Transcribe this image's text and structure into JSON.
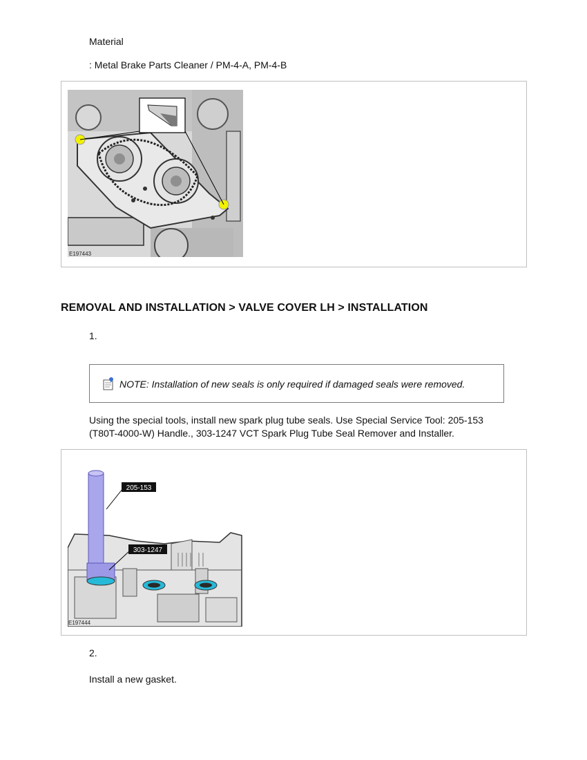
{
  "material": {
    "heading": "Material",
    "line": ": Metal Brake Parts Cleaner / PM-4-A, PM-4-B"
  },
  "figures": {
    "fig1_id": "E197443",
    "fig2_id": "E197444",
    "fig2_callout_handle": "205-153",
    "fig2_callout_tool": "303-1247"
  },
  "section": {
    "title": "REMOVAL AND INSTALLATION > VALVE COVER LH > INSTALLATION"
  },
  "step1": {
    "number": "1.",
    "note": "NOTE: Installation of new seals is only required if damaged seals were removed.",
    "text_line1": "Using the special tools, install new spark plug tube seals. Use Special Service Tool: 205-153",
    "text_line2": "(T80T-4000-W) Handle., 303-1247 VCT Spark Plug Tube Seal Remover and Installer."
  },
  "step2": {
    "number": "2.",
    "text": "Install a new gasket."
  }
}
